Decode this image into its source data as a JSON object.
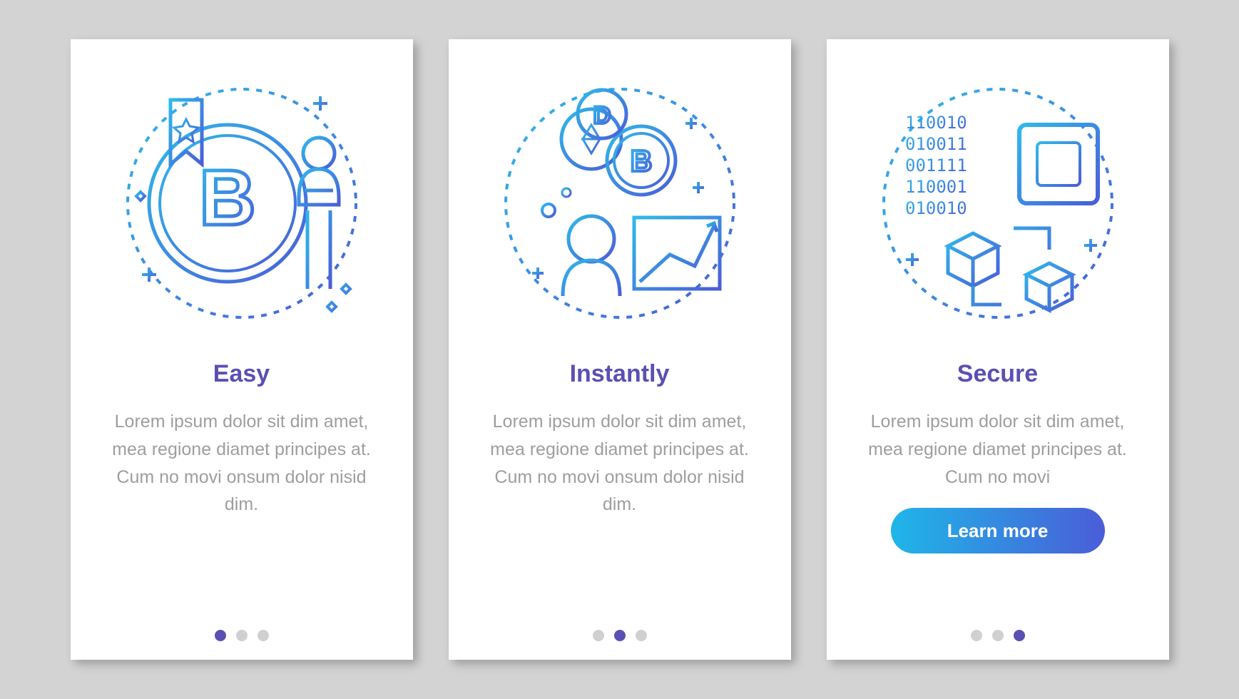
{
  "colors": {
    "title": "#5b4fb3",
    "text": "#9e9e9e",
    "activeDot": "#5b4fb3",
    "inactiveDot": "#d0d0d0",
    "gradientStart": "#1fb6e8",
    "gradientEnd": "#4a5dd8"
  },
  "screens": [
    {
      "title": "Easy",
      "description": "Lorem ipsum dolor sit dim amet, mea regione diamet principes at. Cum no movi onsum dolor nisid dim.",
      "activeIndex": 0,
      "illustration": "bitcoin-user",
      "cta": null
    },
    {
      "title": "Instantly",
      "description": "Lorem ipsum dolor sit dim amet, mea regione diamet principes at. Cum no movi onsum dolor nisid dim.",
      "activeIndex": 1,
      "illustration": "coins-chart",
      "cta": null
    },
    {
      "title": "Secure",
      "description": "Lorem ipsum dolor sit dim amet, mea regione diamet principes at. Cum no movi",
      "activeIndex": 2,
      "illustration": "chip-binary",
      "cta": "Learn more"
    }
  ],
  "dotCount": 3
}
